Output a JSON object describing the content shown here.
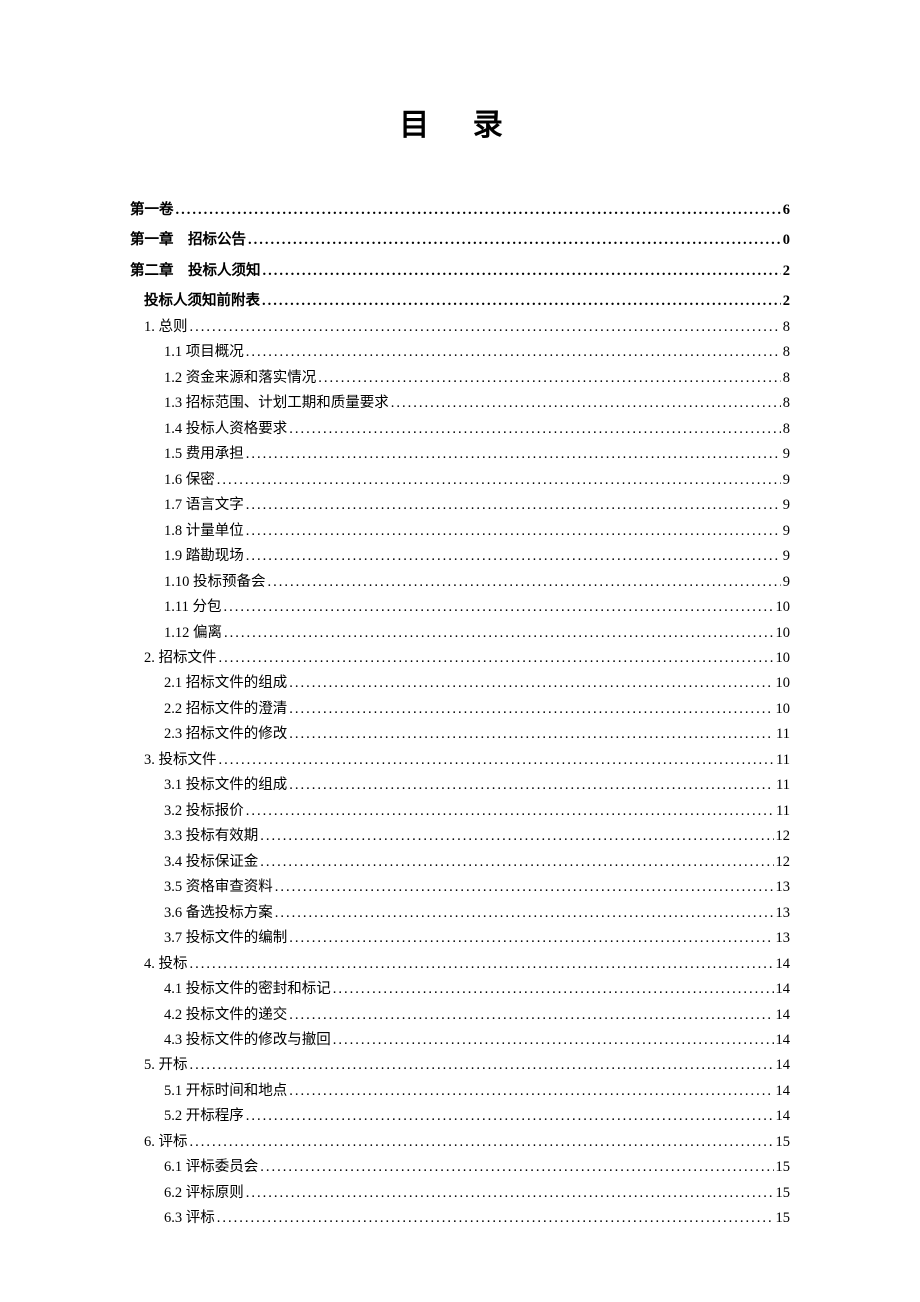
{
  "title": "目 录",
  "entries": [
    {
      "level": "l0",
      "label": "第一卷",
      "page": "6"
    },
    {
      "level": "l0",
      "label": "第一章　招标公告",
      "page": "0"
    },
    {
      "level": "l0",
      "label": "第二章　投标人须知",
      "page": "2"
    },
    {
      "level": "l1",
      "label": "投标人须知前附表",
      "page": "2"
    },
    {
      "level": "l2",
      "label": "1. 总则",
      "page": "8"
    },
    {
      "level": "l3",
      "label": "1.1 项目概况",
      "page": "8"
    },
    {
      "level": "l3",
      "label": "1.2 资金来源和落实情况",
      "page": "8"
    },
    {
      "level": "l3",
      "label": "1.3 招标范围、计划工期和质量要求",
      "page": "8"
    },
    {
      "level": "l3",
      "label": "1.4 投标人资格要求",
      "page": "8"
    },
    {
      "level": "l3",
      "label": "1.5 费用承担",
      "page": "9"
    },
    {
      "level": "l3",
      "label": "1.6 保密",
      "page": "9"
    },
    {
      "level": "l3",
      "label": "1.7 语言文字",
      "page": "9"
    },
    {
      "level": "l3",
      "label": "1.8 计量单位",
      "page": "9"
    },
    {
      "level": "l3",
      "label": "1.9 踏勘现场",
      "page": "9"
    },
    {
      "level": "l3",
      "label": "1.10 投标预备会",
      "page": "9"
    },
    {
      "level": "l3",
      "label": "1.11 分包",
      "page": "10"
    },
    {
      "level": "l3",
      "label": "1.12 偏离",
      "page": "10"
    },
    {
      "level": "l2",
      "label": "2. 招标文件",
      "page": "10"
    },
    {
      "level": "l3",
      "label": "2.1 招标文件的组成",
      "page": "10"
    },
    {
      "level": "l3",
      "label": "2.2 招标文件的澄清",
      "page": "10"
    },
    {
      "level": "l3",
      "label": "2.3 招标文件的修改",
      "page": "11"
    },
    {
      "level": "l2",
      "label": "3. 投标文件",
      "page": "11"
    },
    {
      "level": "l3",
      "label": "3.1 投标文件的组成",
      "page": "11"
    },
    {
      "level": "l3",
      "label": "3.2 投标报价",
      "page": "11"
    },
    {
      "level": "l3",
      "label": "3.3 投标有效期",
      "page": "12"
    },
    {
      "level": "l3",
      "label": "3.4 投标保证金",
      "page": "12"
    },
    {
      "level": "l3",
      "label": "3.5 资格审查资料",
      "page": "13"
    },
    {
      "level": "l3",
      "label": "3.6 备选投标方案",
      "page": "13"
    },
    {
      "level": "l3",
      "label": "3.7 投标文件的编制",
      "page": "13"
    },
    {
      "level": "l2",
      "label": "4. 投标",
      "page": "14"
    },
    {
      "level": "l3",
      "label": "4.1 投标文件的密封和标记",
      "page": "14"
    },
    {
      "level": "l3",
      "label": "4.2 投标文件的递交",
      "page": "14"
    },
    {
      "level": "l3",
      "label": "4.3 投标文件的修改与撤回",
      "page": "14"
    },
    {
      "level": "l2",
      "label": "5. 开标",
      "page": "14"
    },
    {
      "level": "l3",
      "label": "5.1 开标时间和地点",
      "page": "14"
    },
    {
      "level": "l3",
      "label": "5.2 开标程序",
      "page": "14"
    },
    {
      "level": "l2",
      "label": "6. 评标",
      "page": "15"
    },
    {
      "level": "l3",
      "label": "6.1 评标委员会",
      "page": "15"
    },
    {
      "level": "l3",
      "label": "6.2 评标原则",
      "page": "15"
    },
    {
      "level": "l3",
      "label": "6.3 评标",
      "page": "15"
    }
  ]
}
